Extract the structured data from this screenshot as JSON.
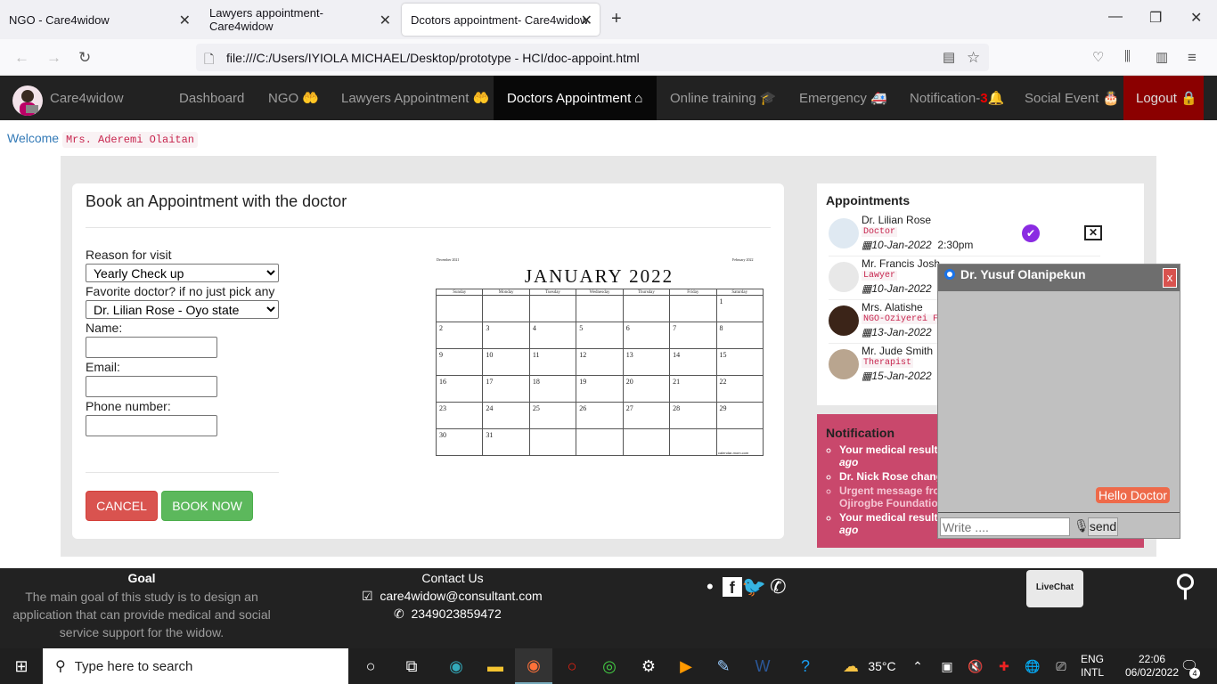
{
  "browser": {
    "tabs": [
      {
        "title": "NGO - Care4widow"
      },
      {
        "title": "Lawyers appointment- Care4widow"
      },
      {
        "title": "Dcotors appointment- Care4widow"
      }
    ],
    "url": "file:///C:/Users/IYIOLA MICHAEL/Desktop/prototype - HCI/doc-appoint.html"
  },
  "nav": {
    "brand": "Care4widow",
    "items": [
      "Dashboard",
      "NGO",
      "Lawyers Appointment",
      "Doctors Appointment",
      "Online training",
      "Emergency",
      "Notification-",
      "Social Event",
      "Logout"
    ],
    "notif_count": "3",
    "active": "Doctors Appointment"
  },
  "welcome": {
    "label": "Welcome",
    "user": "Mrs. Aderemi Olaitan"
  },
  "form": {
    "title": "Book an Appointment with the doctor",
    "reason_label": "Reason for visit",
    "reason_value": "Yearly Check up",
    "doctor_label": "Favorite doctor? if no just pick any",
    "doctor_value": "Dr. Lilian Rose - Oyo state",
    "name_label": "Name:",
    "email_label": "Email:",
    "phone_label": "Phone number:",
    "cancel": "CANCEL",
    "book": "BOOK NOW"
  },
  "calendar": {
    "title": "JANUARY 2022",
    "mini_left": "December 2021",
    "mini_right": "February 2022",
    "days": [
      "Sunday",
      "Monday",
      "Tuesday",
      "Wednesday",
      "Thursday",
      "Friday",
      "Saturday"
    ],
    "weeks": [
      [
        "",
        "",
        "",
        "",
        "",
        "",
        "1"
      ],
      [
        "2",
        "3",
        "4",
        "5",
        "6",
        "7",
        "8"
      ],
      [
        "9",
        "10",
        "11",
        "12",
        "13",
        "14",
        "15"
      ],
      [
        "16",
        "17",
        "18",
        "19",
        "20",
        "21",
        "22"
      ],
      [
        "23",
        "24",
        "25",
        "26",
        "27",
        "28",
        "29"
      ],
      [
        "30",
        "31",
        "",
        "",
        "",
        "",
        ""
      ]
    ],
    "footer": "calendar-mom.com"
  },
  "appointments": {
    "title": "Appointments",
    "items": [
      {
        "name": "Dr. Lilian Rose",
        "role": "Doctor",
        "date": "10-Jan-2022",
        "time": "2:30pm"
      },
      {
        "name": "Mr. Francis Josh",
        "role": "Lawyer",
        "date": "10-Jan-2022",
        "time": ""
      },
      {
        "name": "Mrs. Alatishe",
        "role": "NGO-Oziyerei F",
        "date": "13-Jan-2022",
        "time": ""
      },
      {
        "name": "Mr. Jude Smith",
        "role": "Therapist",
        "date": "15-Jan-2022",
        "time": ""
      }
    ]
  },
  "notification": {
    "title": "Notification",
    "items": [
      {
        "text": "Your medical result",
        "cont": "ago"
      },
      {
        "text": "Dr. Nick Rose chang",
        "cont": ""
      },
      {
        "text": "Urgent message fro",
        "cont": "Ojirogbe Foundation"
      },
      {
        "text": "Your medical result",
        "cont": "ago"
      }
    ]
  },
  "chat": {
    "name": "Dr. Yusuf Olanipekun",
    "close": "x",
    "message": "Hello Doctor",
    "placeholder": "Write ....",
    "send": "send"
  },
  "footer": {
    "goal_title": "Goal",
    "goal_text": "The main goal of this study is to design an application that can provide medical and social service support for the widow.",
    "contact_title": "Contact Us",
    "email": "care4widow@consultant.com",
    "phone": "2349023859472",
    "livechat": "LiveChat"
  },
  "taskbar": {
    "search": "Type here to search",
    "weather": "35°C",
    "lang1": "ENG",
    "lang2": "INTL",
    "time": "22:06",
    "date": "06/02/2022",
    "badge": "4"
  },
  "colors": {
    "navbar": "#222222",
    "active_nav": "#080808",
    "logout": "#8b0000",
    "cancel": "#d9534f",
    "book": "#5cb85c",
    "notif": "#c9486c",
    "chat_msg": "#ee6a4a"
  }
}
